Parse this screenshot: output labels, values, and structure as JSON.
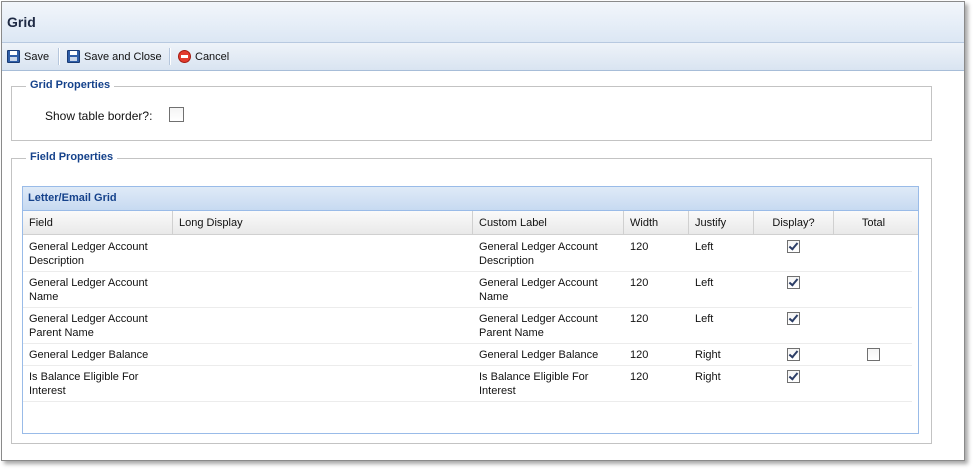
{
  "window": {
    "title": "Grid"
  },
  "toolbar": {
    "save_label": "Save",
    "save_close_label": "Save and Close",
    "cancel_label": "Cancel"
  },
  "grid_properties": {
    "legend": "Grid Properties",
    "show_border_label": "Show table border?:",
    "show_border_checked": false
  },
  "field_properties": {
    "legend": "Field Properties",
    "grid_title": "Letter/Email Grid",
    "columns": [
      "Field",
      "Long Display",
      "Custom Label",
      "Width",
      "Justify",
      "Display?",
      "Total"
    ],
    "rows": [
      {
        "field": "General Ledger Account Description",
        "long_display": "",
        "custom_label": "General Ledger Account Description",
        "width": "120",
        "justify": "Left",
        "display": true,
        "total": null
      },
      {
        "field": "General Ledger Account Name",
        "long_display": "",
        "custom_label": "General Ledger Account Name",
        "width": "120",
        "justify": "Left",
        "display": true,
        "total": null
      },
      {
        "field": "General Ledger Account Parent Name",
        "long_display": "",
        "custom_label": "General Ledger Account Parent Name",
        "width": "120",
        "justify": "Left",
        "display": true,
        "total": null
      },
      {
        "field": "General Ledger Balance",
        "long_display": "",
        "custom_label": "General Ledger Balance",
        "width": "120",
        "justify": "Right",
        "display": true,
        "total": false
      },
      {
        "field": "Is Balance Eligible For Interest",
        "long_display": "",
        "custom_label": "Is Balance Eligible For Interest",
        "width": "120",
        "justify": "Right",
        "display": true,
        "total": null
      }
    ]
  },
  "colors": {
    "accent": "#15428b",
    "header_bg": "#dce7f4",
    "border": "#99bbe8"
  },
  "icons": {
    "save": "save-disk-icon",
    "save_close": "save-disk-icon",
    "cancel": "cancel-circle-icon"
  }
}
